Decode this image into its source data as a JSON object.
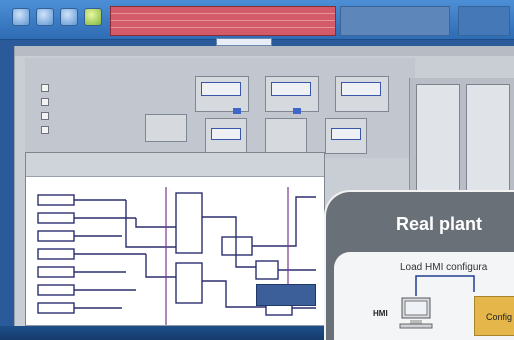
{
  "callout": {
    "title": "Real plant",
    "subtitle": "Load HMI configura",
    "hmi_label": "HMI",
    "config_label": "Config"
  },
  "colors": {
    "alarm": "#d35a68",
    "toolbar": "#2e6cb4",
    "callout_bg": "#6a7078",
    "config_box": "#e5b64a"
  },
  "icons": [
    "acknowledge-icon",
    "silence-icon",
    "navigate-icon",
    "overview-icon"
  ]
}
